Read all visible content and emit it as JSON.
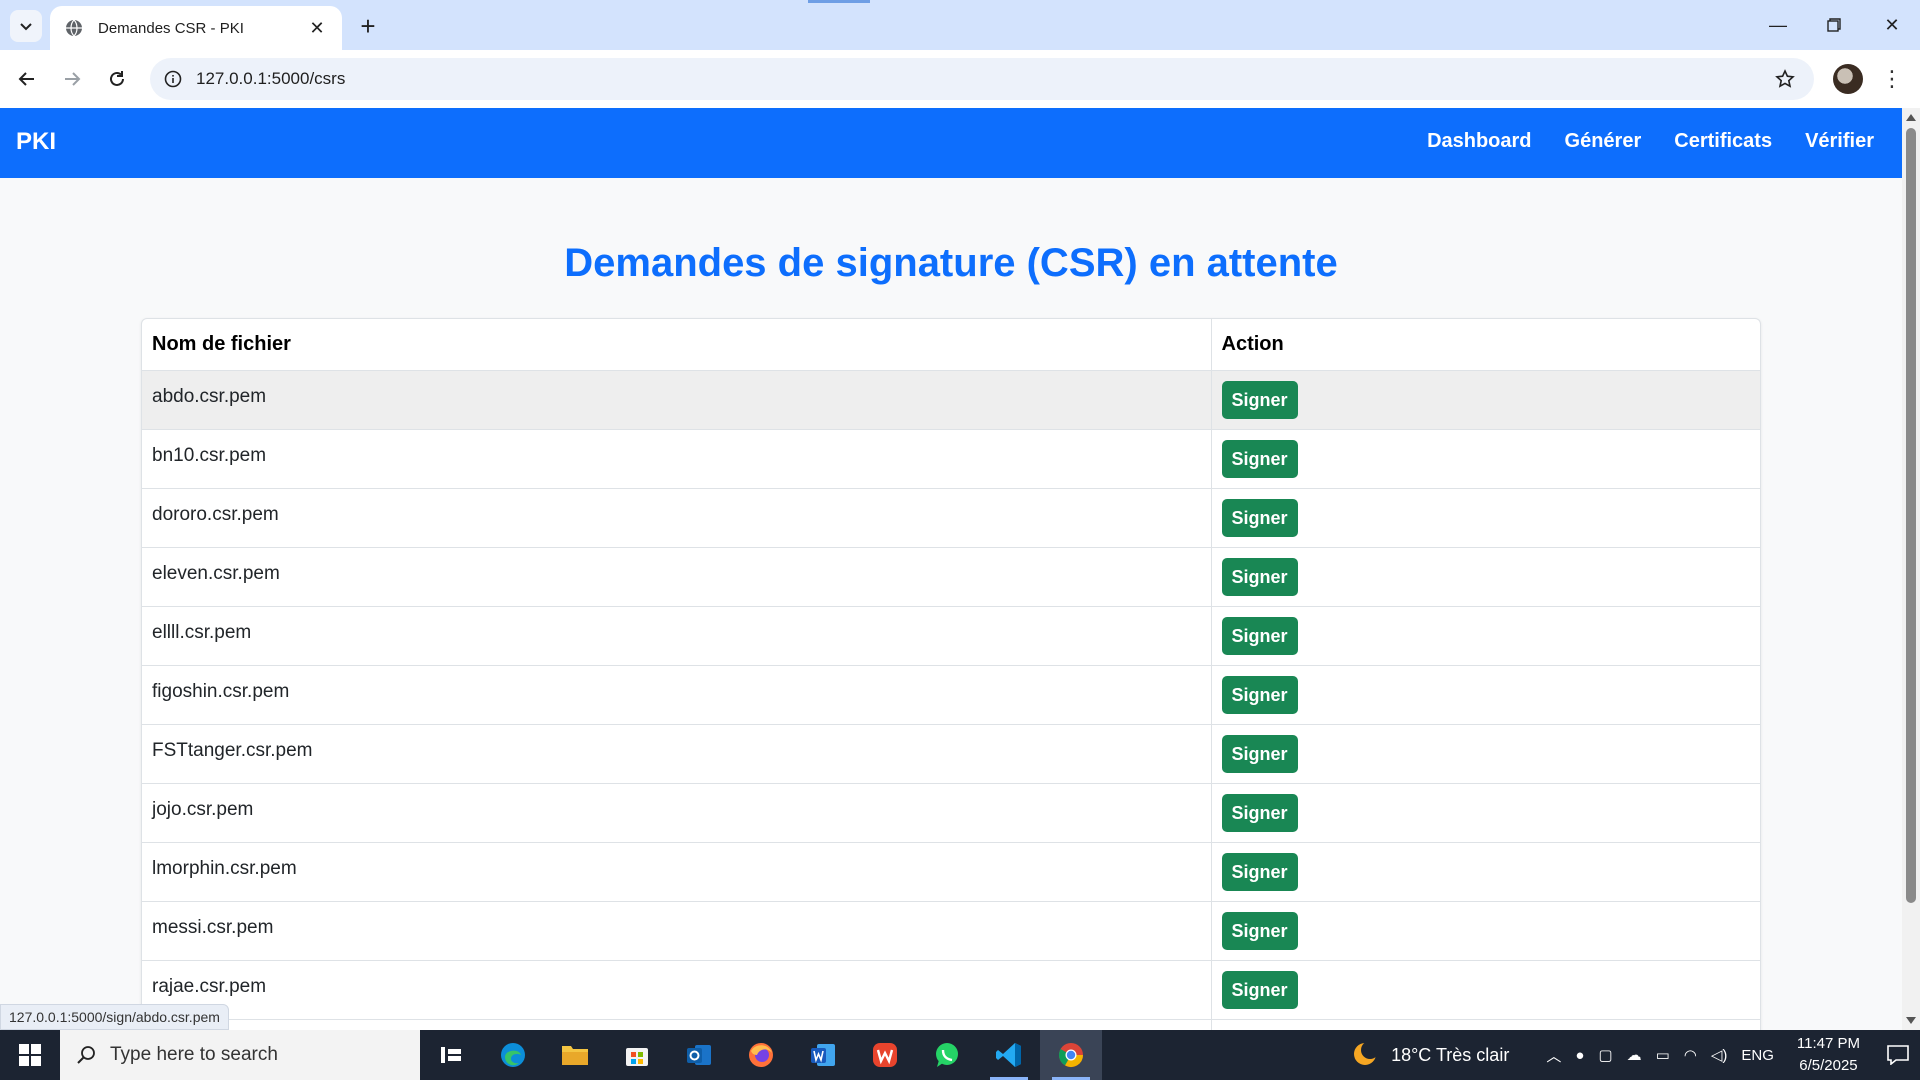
{
  "browser": {
    "tab_title": "Demandes CSR - PKI",
    "url": "127.0.0.1:5000/csrs",
    "status_url": "127.0.0.1:5000/sign/abdo.csr.pem"
  },
  "navbar": {
    "brand": "PKI",
    "links": [
      "Dashboard",
      "Générer",
      "Certificats",
      "Vérifier"
    ]
  },
  "page": {
    "title": "Demandes de signature (CSR) en attente",
    "table": {
      "headers": [
        "Nom de fichier",
        "Action"
      ],
      "button_label": "Signer",
      "rows": [
        "abdo.csr.pem",
        "bn10.csr.pem",
        "dororo.csr.pem",
        "eleven.csr.pem",
        "ellll.csr.pem",
        "figoshin.csr.pem",
        "FSTtanger.csr.pem",
        "jojo.csr.pem",
        "lmorphin.csr.pem",
        "messi.csr.pem",
        "rajae.csr.pem",
        ""
      ]
    }
  },
  "taskbar": {
    "search_placeholder": "Type here to search",
    "weather": "18°C  Très clair",
    "language": "ENG",
    "time": "11:47 PM",
    "date": "6/5/2025",
    "apps": [
      "task-view",
      "edge",
      "file-explorer",
      "store",
      "outlook",
      "firefox",
      "word",
      "wps",
      "whatsapp",
      "vscode",
      "chrome"
    ]
  },
  "colors": {
    "primary": "#0d6efd",
    "success": "#198754",
    "page_bg": "#f8f9fa"
  }
}
